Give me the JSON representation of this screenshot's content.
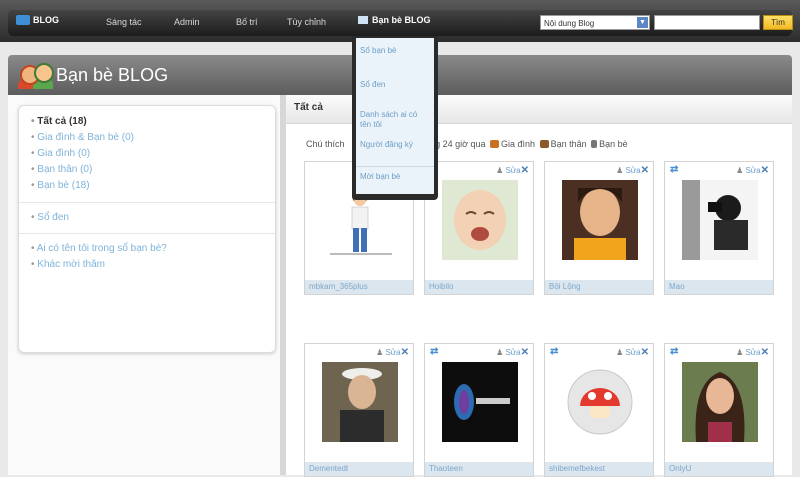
{
  "nav": {
    "logo": "BLOG",
    "items": [
      "Sáng tác",
      "Admin",
      "Bố trí",
      "Tùy chỉnh"
    ],
    "active": "Bạn bè BLOG",
    "select_value": "Nội dung Blog",
    "search_button": "Tìm"
  },
  "header": {
    "title": "Bạn bè BLOG"
  },
  "sidebar": {
    "group1": [
      "Tất cả (18)",
      "Gia đình & Bạn bè (0)",
      "Gia đình (0)",
      "Bạn thân (0)",
      "Bạn bè (18)"
    ],
    "group2": [
      "Sổ đen"
    ],
    "group3": [
      "Ai có tên tôi trong sổ bạn bè?",
      "Khác mời thăm"
    ]
  },
  "content": {
    "tab": "Tất cả",
    "legend": {
      "prefix": "Chú thích",
      "suffix": "trong 24 giờ qua",
      "family": "Gia đình",
      "close": "Bạn thân",
      "friend": "Bạn bè"
    }
  },
  "card_actions": {
    "edit": "Sửa",
    "delete": "✕",
    "sync": "⇄"
  },
  "friends": [
    {
      "name": "mbkam_365plus"
    },
    {
      "name": "Hoibilo"
    },
    {
      "name": "Bội Lộng"
    },
    {
      "name": "Mao"
    },
    {
      "name": "Dementedt"
    },
    {
      "name": "Thaoteen"
    },
    {
      "name": "shibemefbekest"
    },
    {
      "name": "OnlyU"
    }
  ],
  "dropdown": [
    "Sổ bạn bè",
    "Sổ đen",
    "Danh sách ai có tên tôi",
    "Người đăng ký",
    "Mời bạn bè"
  ],
  "colors": {
    "accent": "#5b87c5",
    "link": "#7fb3d8",
    "button": "#f2b822"
  }
}
